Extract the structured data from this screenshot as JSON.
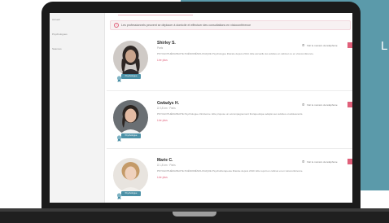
{
  "background": {
    "accent_color": "#5b9aaa",
    "partial_letter": "L"
  },
  "sidebar": {
    "items": [
      {
        "label": "Accueil"
      },
      {
        "label": "Psychologues"
      },
      {
        "label": "Séances"
      }
    ]
  },
  "info_banner": {
    "icon": "info-icon",
    "text": "Les professionnels peuvent se déplacer à domicile et effectuer des consultations en visioconférence"
  },
  "profiles": [
    {
      "name": "Shirley S.",
      "location": "Paris",
      "description": "PSYCHOTHÉRAPEUTE PHÉNOMÉNOLOGIQUE Psychologue libérale depuis 2014. Elle accueille les adultes en cabinet ou en visioconférence.",
      "more_label": "Lire plus",
      "action_label": "Voir le numéro de téléphone",
      "badge_label": "Psychologue",
      "avatar": "avatar-photo"
    },
    {
      "name": "Gwladys H.",
      "location": "À 0,8 km · Paris",
      "description": "PSYCHOTHÉRAPEUTE Psychologue clinicienne. Elle propose un accompagnement thérapeutique adapté aux adultes et adolescents.",
      "more_label": "Lire plus",
      "action_label": "Voir le numéro de téléphone",
      "badge_label": "Psychologue",
      "avatar": "avatar-photo"
    },
    {
      "name": "Marie C.",
      "location": "À 1,8 km · Paris",
      "description": "PSYCHOTHÉRAPEUTE PHÉNOMÉNOLOGIQUE Psychothérapeute libérale depuis 2010. Elle reçoit en cabinet et en visioconférence.",
      "more_label": "Lire plus",
      "action_label": "Voir le numéro de téléphone",
      "badge_label": "Psychologue",
      "avatar": "avatar-photo"
    }
  ]
}
